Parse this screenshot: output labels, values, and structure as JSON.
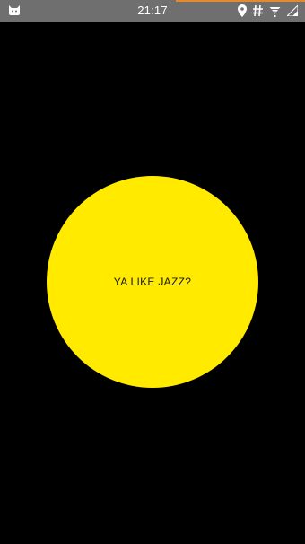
{
  "status_bar": {
    "time": "21:17",
    "app_icon": "cat-icon",
    "icons": [
      "location-pin-icon",
      "hash-icon",
      "wifi-icon",
      "signal-icon"
    ],
    "background_color": "#6f6f6f",
    "progress_color": "#e38a2c"
  },
  "main": {
    "button_label": "YA LIKE JAZZ?",
    "button_color": "#ffea00",
    "background_color": "#000000"
  }
}
